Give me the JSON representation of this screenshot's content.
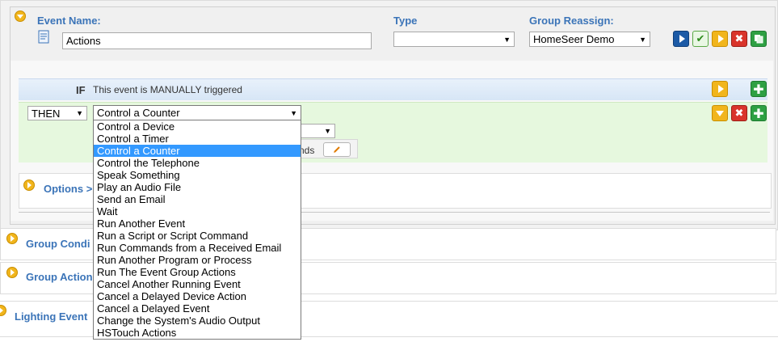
{
  "event": {
    "name_label": "Event Name:",
    "name_value": "Actions",
    "type_label": "Type",
    "type_value": "",
    "group_label": "Group Reassign:",
    "group_value": "HomeSeer Demo"
  },
  "trigger": {
    "keyword": "IF",
    "text": "This event is MANUALLY triggered"
  },
  "action": {
    "keyword": "THEN",
    "selected": "Control a Counter",
    "partial_text": "nds",
    "options": [
      "Control a Device",
      "Control a Timer",
      "Control a Counter",
      "Control the Telephone",
      "Speak Something",
      "Play an Audio File",
      "Send an Email",
      "Wait",
      "Run Another Event",
      "Run a Script or Script Command",
      "Run Commands from a Received Email",
      "Run Another Program or Process",
      "Run The Event Group Actions",
      "Cancel Another Running Event",
      "Cancel a Delayed Device Action",
      "Cancel a Delayed Event",
      "Change the System's Audio Output",
      "HSTouch Actions"
    ]
  },
  "sections": {
    "options": "Options >",
    "group_conditions": "Group Condi",
    "group_actions": "Group Action",
    "lighting_events": "Lighting Event"
  },
  "colors": {
    "accent_blue": "#3b74b8",
    "selected_item": "#3399ff",
    "yellow_icon": "#f1b51c",
    "green_button": "#2ea043",
    "red_button": "#d9342b",
    "blue_button": "#1c5aa6"
  }
}
